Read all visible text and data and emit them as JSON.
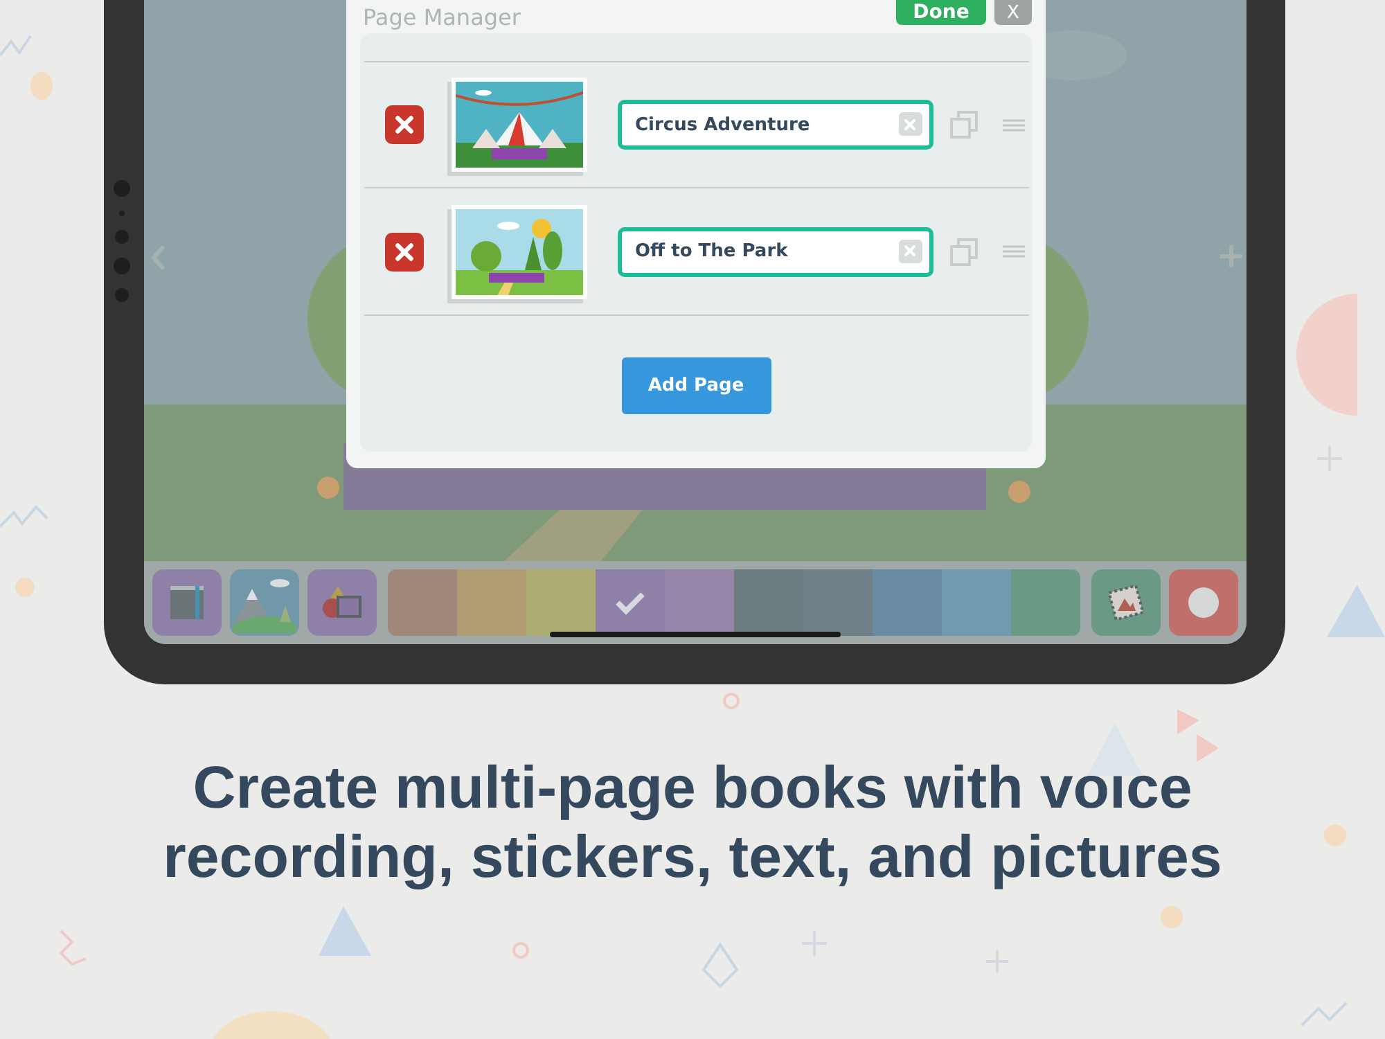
{
  "dialog": {
    "title": "Page Manager",
    "done_button": "Done",
    "close_button": "X",
    "pages": [
      {
        "title": "Circus Adventure",
        "kind": "circus"
      },
      {
        "title": "Off to The Park",
        "kind": "park"
      }
    ],
    "add_button": "Add Page"
  },
  "toolbar": {
    "tools": [
      {
        "kind": "book"
      },
      {
        "kind": "scene"
      },
      {
        "kind": "shapes"
      }
    ],
    "colors": [
      {
        "color": "#a08878",
        "selected": false
      },
      {
        "color": "#b09c72",
        "selected": false
      },
      {
        "color": "#adac72",
        "selected": false
      },
      {
        "color": "#8f80a8",
        "selected": true
      },
      {
        "color": "#9585a8",
        "selected": false
      },
      {
        "color": "#6b7b80",
        "selected": false
      },
      {
        "color": "#708088",
        "selected": false
      },
      {
        "color": "#6a8ca2",
        "selected": false
      },
      {
        "color": "#7099b2",
        "selected": false
      },
      {
        "color": "#6a9a86",
        "selected": false
      }
    ],
    "actions": [
      {
        "kind": "sticker"
      },
      {
        "kind": "record"
      }
    ]
  },
  "headline": "Create multi-page books with voice recording, stickers, text, and pictures"
}
